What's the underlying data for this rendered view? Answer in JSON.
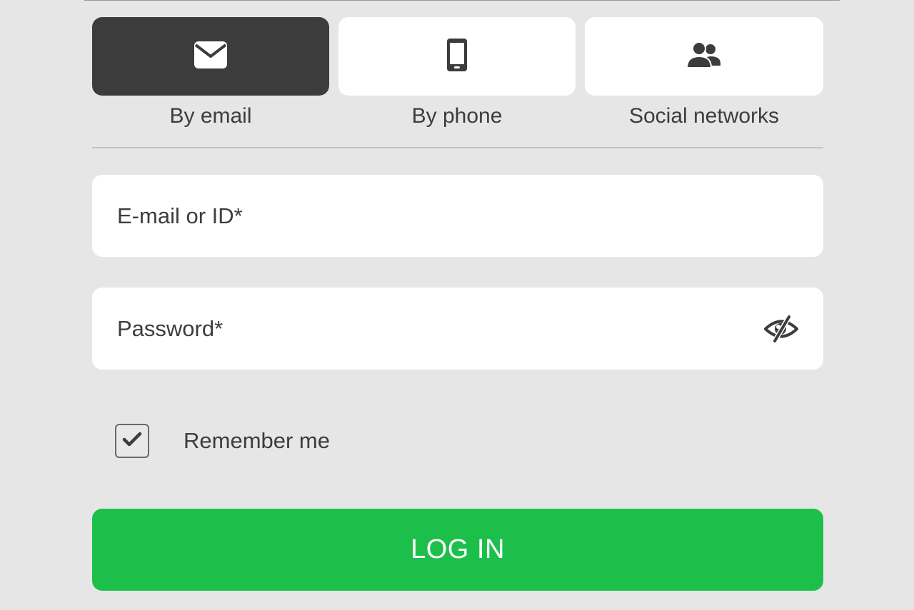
{
  "login_methods": {
    "tabs": [
      {
        "label": "By email",
        "icon": "envelope-icon",
        "active": true
      },
      {
        "label": "By phone",
        "icon": "mobile-phone-icon",
        "active": false
      },
      {
        "label": "Social networks",
        "icon": "users-icon",
        "active": false
      }
    ]
  },
  "form": {
    "email": {
      "placeholder": "E-mail or ID*",
      "value": ""
    },
    "password": {
      "placeholder": "Password*",
      "value": "",
      "toggle_icon": "eye-slash-icon"
    },
    "remember_me": {
      "label": "Remember me",
      "checked": true
    },
    "submit_label": "LOG IN"
  },
  "colors": {
    "background": "#e6e6e6",
    "active_tab": "#3c3c3c",
    "inactive_tab": "#ffffff",
    "text": "#3d3d3d",
    "login_button": "#1dbf4b"
  }
}
